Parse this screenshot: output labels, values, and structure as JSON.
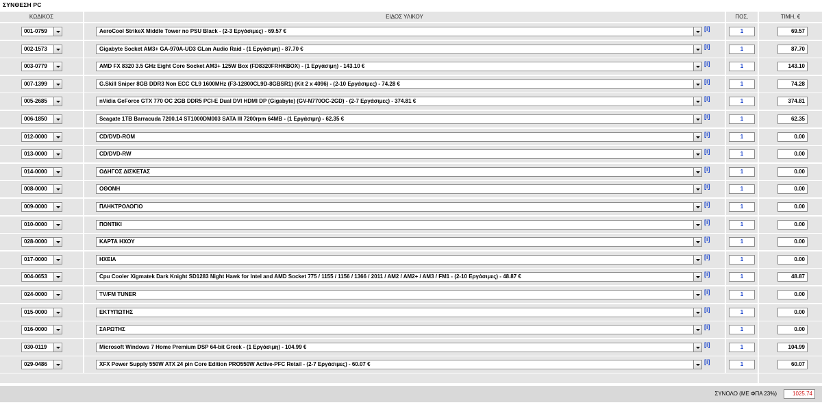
{
  "title": "ΣΥΝΘΕΣΗ PC",
  "headers": {
    "code": "ΚΩΔΙΚΟΣ",
    "desc": "ΕΙΔΟΣ ΥΛΙΚΟΥ",
    "qty": "ΠΟΣ.",
    "price": "ΤΙΜΗ, €"
  },
  "info_label": "[i]",
  "rows": [
    {
      "code": "001-0759",
      "desc": "AeroCool StrikeX Middle Tower no PSU Black - (2-3 Εργάσιμες) - 69.57 €",
      "qty": "1",
      "price": "69.57"
    },
    {
      "code": "002-1573",
      "desc": "Gigabyte Socket AM3+ GA-970A-UD3 GLan Audio Raid - (1 Εργάσιμη) - 87.70 €",
      "qty": "1",
      "price": "87.70"
    },
    {
      "code": "003-0779",
      "desc": "AMD FX 8320 3.5 GHz Eight Core Socket AM3+ 125W Box (FD8320FRHKBOX) - (1 Εργάσιμη) - 143.10 €",
      "qty": "1",
      "price": "143.10"
    },
    {
      "code": "007-1399",
      "desc": "G.Skill Sniper 8GB DDR3 Non ECC CL9 1600MHz (F3-12800CL9D-8GBSR1) (Kit 2 x 4096) - (2-10 Εργάσιμες) - 74.28 €",
      "qty": "1",
      "price": "74.28"
    },
    {
      "code": "005-2685",
      "desc": "nVidia GeForce GTX 770 OC 2GB DDR5 PCI-E Dual DVI HDMI DP (Gigabyte) (GV-N770OC-2GD) - (2-7 Εργάσιμες) - 374.81 €",
      "qty": "1",
      "price": "374.81"
    },
    {
      "code": "006-1850",
      "desc": "Seagate 1TB Barracuda 7200.14 ST1000DM003 SATA III 7200rpm 64MB - (1 Εργάσιμη) - 62.35 €",
      "qty": "1",
      "price": "62.35"
    },
    {
      "code": "012-0000",
      "desc": "CD/DVD-ROM",
      "qty": "1",
      "price": "0.00"
    },
    {
      "code": "013-0000",
      "desc": "CD/DVD-RW",
      "qty": "1",
      "price": "0.00"
    },
    {
      "code": "014-0000",
      "desc": "ΟΔΗΓΟΣ ΔΙΣΚΕΤΑΣ",
      "qty": "1",
      "price": "0.00"
    },
    {
      "code": "008-0000",
      "desc": "ΟΘΟΝΗ",
      "qty": "1",
      "price": "0.00"
    },
    {
      "code": "009-0000",
      "desc": "ΠΛΗΚΤΡΟΛΟΓΙΟ",
      "qty": "1",
      "price": "0.00"
    },
    {
      "code": "010-0000",
      "desc": "ΠΟΝΤΙΚΙ",
      "qty": "1",
      "price": "0.00"
    },
    {
      "code": "028-0000",
      "desc": "ΚΑΡΤΑ ΗΧΟΥ",
      "qty": "1",
      "price": "0.00"
    },
    {
      "code": "017-0000",
      "desc": "ΗΧΕΙΑ",
      "qty": "1",
      "price": "0.00"
    },
    {
      "code": "004-0653",
      "desc": "Cpu Cooler Xigmatek Dark Knight SD1283 Night Hawk for Intel and AMD Socket 775 / 1155 / 1156 / 1366 / 2011 / AM2 / AM2+ / AM3 / FM1 - (2-10 Εργάσιμες) - 48.87 €",
      "qty": "1",
      "price": "48.87"
    },
    {
      "code": "024-0000",
      "desc": "TV/FM TUNER",
      "qty": "1",
      "price": "0.00"
    },
    {
      "code": "015-0000",
      "desc": "ΕΚΤΥΠΩΤΗΣ",
      "qty": "1",
      "price": "0.00"
    },
    {
      "code": "016-0000",
      "desc": "ΣΑΡΩΤΗΣ",
      "qty": "1",
      "price": "0.00"
    },
    {
      "code": "030-0119",
      "desc": "Microsoft Windows 7 Home Premium DSP 64-bit Greek - (1 Εργάσιμη) - 104.99 €",
      "qty": "1",
      "price": "104.99"
    },
    {
      "code": "029-0486",
      "desc": "XFX Power Supply 550W ATX 24 pin Core Edition PRO550W Active-PFC Retail - (2-7 Εργάσιμες) - 60.07 €",
      "qty": "1",
      "price": "60.07"
    }
  ],
  "total": {
    "label": "ΣΥΝΟΛΟ (ΜΕ ΦΠΑ 23%)",
    "value": "1025.74"
  }
}
